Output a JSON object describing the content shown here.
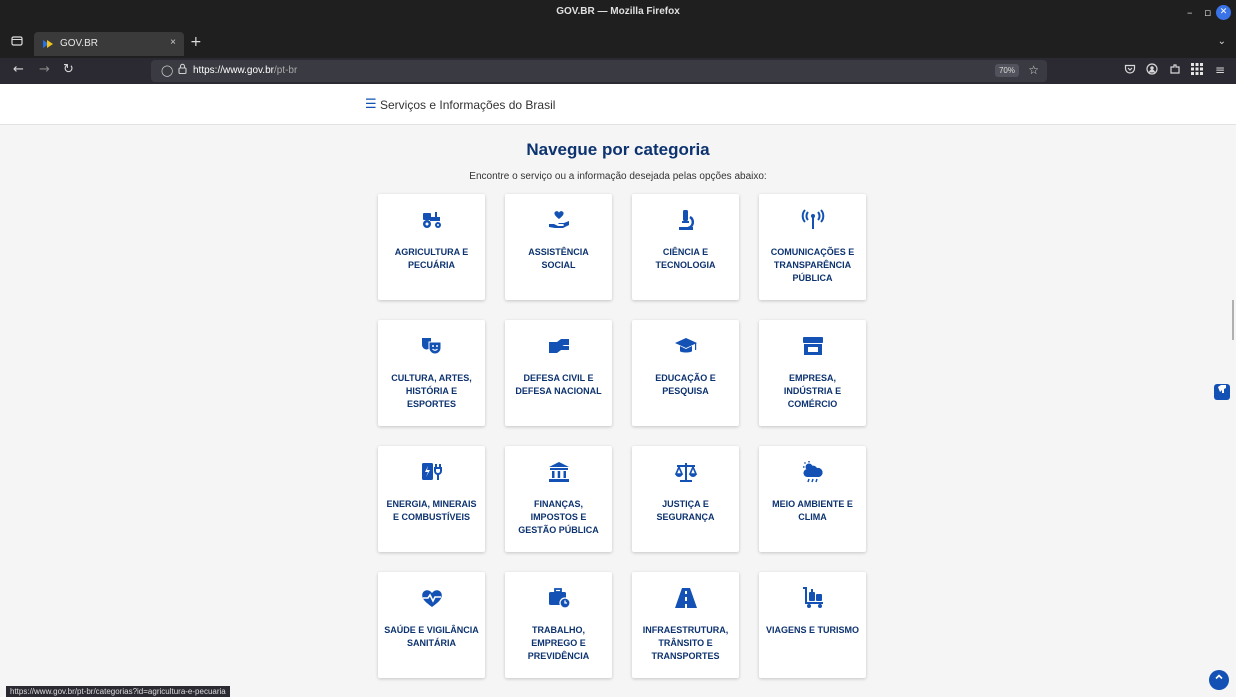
{
  "window": {
    "title": "GOV.BR — Mozilla Firefox",
    "minimize": "–",
    "maximize": "▫",
    "close": "✕"
  },
  "tabs": [
    {
      "label": "GOV.BR",
      "close": "×"
    }
  ],
  "tabbar": {
    "new_tab": "+",
    "list_all": "⌄"
  },
  "nav": {
    "url_host": "https://www.gov.br",
    "url_path": "/pt-br",
    "zoom": "70%"
  },
  "site": {
    "menu_icon": "☰",
    "title": "Serviços e Informações do Brasil"
  },
  "main": {
    "heading": "Navegue por categoria",
    "subheading": "Encontre o serviço ou a informação desejada pelas opções abaixo:",
    "categories": [
      {
        "label": "AGRICULTURA E PECUÁRIA",
        "icon": "tractor-icon"
      },
      {
        "label": "ASSISTÊNCIA SOCIAL",
        "icon": "hand-heart-icon"
      },
      {
        "label": "CIÊNCIA E TECNOLOGIA",
        "icon": "microscope-icon"
      },
      {
        "label": "COMUNICAÇÕES E TRANSPARÊNCIA PÚBLICA",
        "icon": "antenna-icon"
      },
      {
        "label": "CULTURA, ARTES, HISTÓRIA E ESPORTES",
        "icon": "theater-masks-icon"
      },
      {
        "label": "DEFESA CIVIL E DEFESA NACIONAL",
        "icon": "handshake-icon"
      },
      {
        "label": "EDUCAÇÃO E PESQUISA",
        "icon": "graduation-cap-icon"
      },
      {
        "label": "EMPRESA, INDÚSTRIA E COMÉRCIO",
        "icon": "store-icon"
      },
      {
        "label": "ENERGIA, MINERAIS E COMBUSTÍVEIS",
        "icon": "energy-plug-icon"
      },
      {
        "label": "FINANÇAS, IMPOSTOS E GESTÃO PÚBLICA",
        "icon": "bank-building-icon"
      },
      {
        "label": "JUSTIÇA E SEGURANÇA",
        "icon": "scale-icon"
      },
      {
        "label": "MEIO AMBIENTE E CLIMA",
        "icon": "weather-cloud-icon"
      },
      {
        "label": "SAÚDE E VIGILÂNCIA SANITÁRIA",
        "icon": "heartbeat-icon"
      },
      {
        "label": "TRABALHO, EMPREGO E PREVIDÊNCIA",
        "icon": "briefcase-clock-icon"
      },
      {
        "label": "INFRAESTRUTURA, TRÂNSITO E TRANSPORTES",
        "icon": "road-icon"
      },
      {
        "label": "VIAGENS E TURISMO",
        "icon": "luggage-cart-icon"
      }
    ]
  },
  "statusbar": {
    "link": "https://www.gov.br/pt-br/categorias?id=agricultura-e-pecuaria"
  },
  "colors": {
    "brand_blue": "#1351b4",
    "heading_navy": "#0c326f"
  }
}
